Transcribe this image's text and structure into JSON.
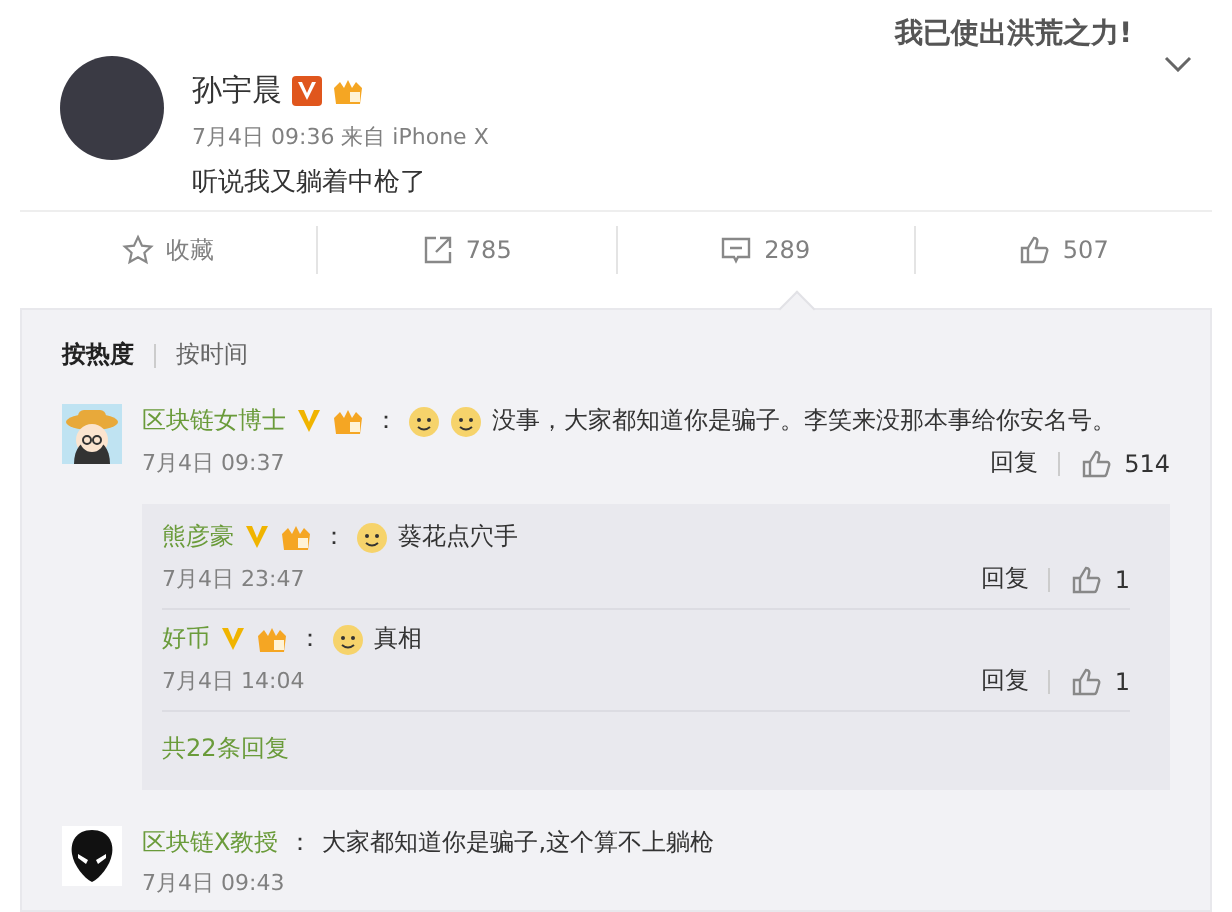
{
  "sticker": "我已使出洪荒之力!",
  "post": {
    "author": "孙宇晨",
    "meta": "7月4日 09:36 来自 iPhone X",
    "text": "听说我又躺着中枪了"
  },
  "actions": [
    {
      "kind": "favorite",
      "label": "收藏"
    },
    {
      "kind": "repost",
      "label": "785"
    },
    {
      "kind": "comment",
      "label": "289"
    },
    {
      "kind": "like",
      "label": "507"
    }
  ],
  "sort_tabs": [
    {
      "label": "按热度",
      "selected": true
    },
    {
      "label": "按时间",
      "selected": false
    }
  ],
  "comments": [
    {
      "author": "区块链女博士",
      "avatar": {
        "kind": "girl"
      },
      "badges": true,
      "colon": "：",
      "emojis": [
        {
          "kind": "smiley"
        },
        {
          "kind": "smiley"
        }
      ],
      "text": "没事，大家都知道你是骗子。李笑来没那本事给你安名号。",
      "time": "7月4日 09:37",
      "reply": "回复",
      "likes": "514",
      "replies": [
        {
          "author": "熊彦豪",
          "colon": "：",
          "emojis": [
            {
              "kind": "smiley"
            }
          ],
          "text": "葵花点穴手",
          "time": "7月4日 23:47",
          "reply": "回复",
          "likes": "1"
        },
        {
          "author": "好币",
          "colon": "：",
          "emojis": [
            {
              "kind": "smiley"
            }
          ],
          "text": "真相",
          "time": "7月4日 14:04",
          "reply": "回复",
          "likes": "1"
        }
      ],
      "more": "共22条回复"
    },
    {
      "author": "区块链X教授",
      "avatar": {
        "kind": "alien"
      },
      "badges": false,
      "colon": "：",
      "text": "大家都知道你是骗子,这个算不上躺枪",
      "time": "7月4日 09:43"
    }
  ]
}
